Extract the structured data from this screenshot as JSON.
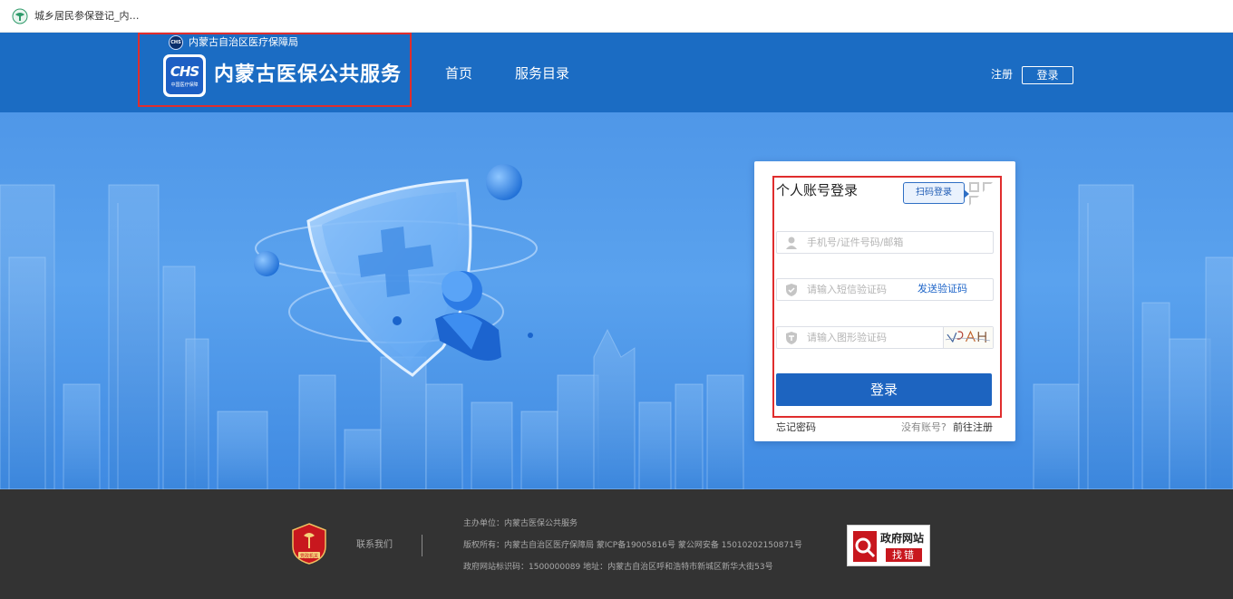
{
  "browser": {
    "tab_title": "城乡居民参保登记_内…",
    "favicon": "chs-globe-icon"
  },
  "header": {
    "org_name": "内蒙古自治区医疗保障局",
    "logo_text": "CHS",
    "logo_subtext": "中国医疗保障",
    "site_title": "内蒙古医保公共服务",
    "nav": [
      "首页",
      "服务目录"
    ],
    "register_label": "注册",
    "login_label": "登录",
    "highlight_color": "#e02d2d",
    "brand_color": "#1b6cc3"
  },
  "login": {
    "title": "个人账号登录",
    "qr_tip": "扫码登录",
    "phone_placeholder": "手机号/证件号码/邮箱",
    "sms_placeholder": "请输入短信验证码",
    "send_code": "发送验证码",
    "img_placeholder": "请输入图形验证码",
    "captcha_text": "VPAH",
    "submit": "登录",
    "forgot": "忘记密码",
    "no_account": "没有账号?",
    "go_register": "前往注册",
    "button_color": "#1d64c0"
  },
  "footer": {
    "contact": "联系我们",
    "host": "主办单位：内蒙古医保公共服务",
    "copyright": "版权所有：内蒙古自治区医疗保障局 蒙ICP备19005816号 蒙公网安备 15010202150871号",
    "site_code": "政府网站标识码：1500000089  地址：内蒙古自治区呼和浩特市新城区新华大街53号",
    "gov_badge_title": "政府网站",
    "gov_badge_sub": "找错",
    "party_badge": "党政机关",
    "background": "#333333"
  }
}
